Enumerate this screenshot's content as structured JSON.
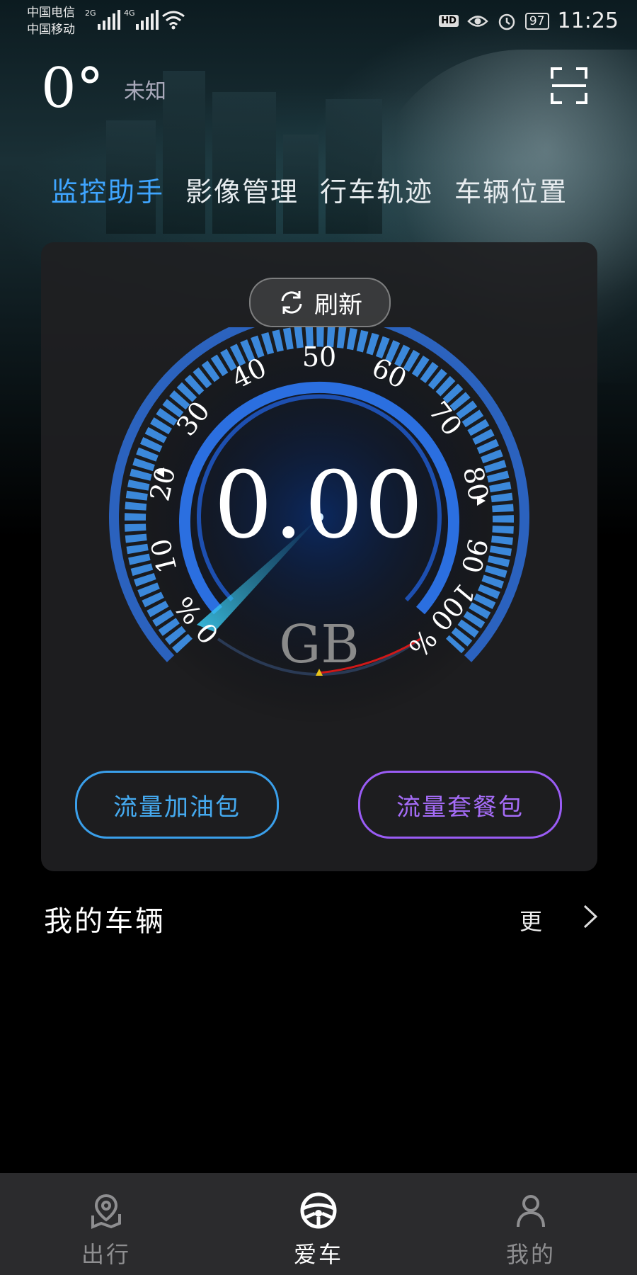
{
  "status_bar": {
    "carrier1": "中国电信",
    "carrier2": "中国移动",
    "net1": "2G",
    "net2": "4G",
    "hd": "HD",
    "battery": "97",
    "time": "11:25"
  },
  "header": {
    "temperature": "0°",
    "weather": "未知",
    "scan_icon": "scan-icon"
  },
  "tabs": [
    {
      "label": "监控助手",
      "active": true
    },
    {
      "label": "影像管理",
      "active": false
    },
    {
      "label": "行车轨迹",
      "active": false
    },
    {
      "label": "车辆位置",
      "active": false
    }
  ],
  "card": {
    "refresh_label": "刷新",
    "gauge": {
      "value": "0.00",
      "unit": "GB",
      "percent_used": 0,
      "ticks": [
        "0 %",
        "10",
        "20",
        "30",
        "40",
        "50",
        "60",
        "70",
        "80",
        "90",
        "100 %"
      ]
    },
    "buttons": {
      "left": "流量加油包",
      "right": "流量套餐包"
    }
  },
  "vehicles": {
    "title": "我的车辆",
    "more": "更"
  },
  "bottom_nav": [
    {
      "label": "出行",
      "icon": "map-pin-icon",
      "active": false
    },
    {
      "label": "爱车",
      "icon": "steering-wheel-icon",
      "active": true
    },
    {
      "label": "我的",
      "icon": "user-icon",
      "active": false
    }
  ],
  "colors": {
    "accent_blue": "#3fa5ff",
    "button_blue": "#3a9fea",
    "button_purple": "#9a5cf5",
    "gauge_blue": "#2b6fe0"
  }
}
